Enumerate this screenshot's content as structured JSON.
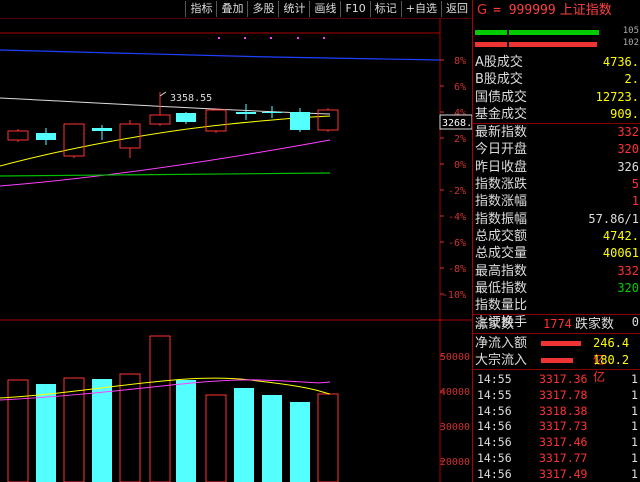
{
  "toolbar": {
    "buttons": [
      "指标",
      "叠加",
      "多股",
      "统计",
      "画线",
      "F10",
      "标记",
      "+自选",
      "返回"
    ]
  },
  "header": {
    "market_letter": "G",
    "code": "= 999999",
    "name": "上证指数"
  },
  "summary_bars": {
    "top_num": "105",
    "bottom_num": "102"
  },
  "stats": [
    {
      "label": "A股成交",
      "value": "4736.",
      "color": "yellow"
    },
    {
      "label": "B股成交",
      "value": "2.",
      "color": "yellow"
    },
    {
      "label": "国债成交",
      "value": "12723.",
      "color": "yellow"
    },
    {
      "label": "基金成交",
      "value": "909.",
      "color": "yellow"
    },
    {
      "label": "最新指数",
      "value": "332",
      "color": "red",
      "sep": true
    },
    {
      "label": "今日开盘",
      "value": "320",
      "color": "red"
    },
    {
      "label": "昨日收盘",
      "value": "326",
      "color": "white"
    },
    {
      "label": "指数涨跌",
      "value": "5",
      "color": "red"
    },
    {
      "label": "指数涨幅",
      "value": "1",
      "color": "red"
    },
    {
      "label": "指数振幅",
      "value": "57.86/1",
      "color": "white"
    },
    {
      "label": "总成交额",
      "value": "4742.",
      "color": "yellow"
    },
    {
      "label": "总成交量",
      "value": "40061",
      "color": "yellow"
    },
    {
      "label": "最高指数",
      "value": "332",
      "color": "red"
    },
    {
      "label": "最低指数",
      "value": "320",
      "color": "green"
    },
    {
      "label": "指数量比",
      "value": "",
      "color": "white"
    },
    {
      "label": "上证换手",
      "value": "0",
      "color": "white"
    }
  ],
  "breadth": {
    "up_label": "涨家数",
    "up_value": "1774",
    "down_label": "跌家数"
  },
  "flows": [
    {
      "label": "净流入额",
      "value": "246.4",
      "unit": "亿"
    },
    {
      "label": "大宗流入",
      "value": "180.2",
      "unit": "亿"
    }
  ],
  "ticks": [
    {
      "time": "14:55",
      "price": "3317.36",
      "vol": "1."
    },
    {
      "time": "14:55",
      "price": "3317.78",
      "vol": "1."
    },
    {
      "time": "14:56",
      "price": "3318.38",
      "vol": "1."
    },
    {
      "time": "14:56",
      "price": "3317.73",
      "vol": "1."
    },
    {
      "time": "14:56",
      "price": "3317.46",
      "vol": "1."
    },
    {
      "time": "14:56",
      "price": "3317.77",
      "vol": "1."
    },
    {
      "time": "14:56",
      "price": "3317.49",
      "vol": "1."
    }
  ],
  "chart_data": {
    "type": "bar",
    "price_axis_pct": [
      "8%",
      "6%",
      "4%",
      "2%",
      "0%",
      "-2%",
      "-4%",
      "-6%",
      "-8%",
      "-10%"
    ],
    "volume_axis": [
      "50000",
      "40000",
      "30000",
      "20000"
    ],
    "current_price_label": "3268.4",
    "high_marker": "3358.55",
    "colors": {
      "up": "#ff3232",
      "down": "#54ffff",
      "ma_white": "#ffffff",
      "ma_yellow": "#ffff00",
      "ma_magenta": "#ff40ff",
      "ma_green": "#00c000",
      "ma_blue": "#2040ff"
    }
  }
}
